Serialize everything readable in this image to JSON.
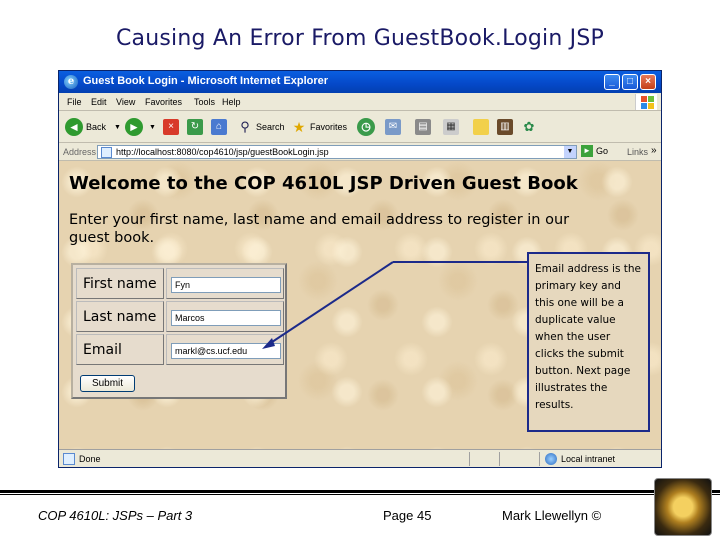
{
  "slide": {
    "title": "Causing An Error From GuestBook.Login JSP",
    "footer_course": "COP 4610L: JSPs – Part 3",
    "footer_page": "Page 45",
    "footer_author": "Mark Llewellyn ©"
  },
  "browser": {
    "window_title": "Guest Book Login - Microsoft Internet Explorer",
    "menu": [
      "File",
      "Edit",
      "View",
      "Favorites",
      "Tools",
      "Help"
    ],
    "toolbar": {
      "back_label": "Back",
      "search_label": "Search",
      "favorites_label": "Favorites"
    },
    "address": {
      "label": "Address",
      "url": "http://localhost:8080/cop4610/jsp/guestBookLogin.jsp",
      "go_label": "Go",
      "links_label": "Links"
    },
    "status": {
      "left": "Done",
      "zone": "Local intranet"
    }
  },
  "page": {
    "heading": "Welcome to the COP 4610L JSP Driven Guest Book",
    "instructions": "Enter your first name, last name and email address to register in our guest book.",
    "form": {
      "first_name_label": "First name",
      "first_name_value": "Fyn",
      "last_name_label": "Last name",
      "last_name_value": "Marcos",
      "email_label": "Email",
      "email_value": "markl@cs.ucf.edu",
      "submit_label": "Submit"
    }
  },
  "callout": {
    "text": "Email address is the primary key and this one will be a duplicate value when the user clicks the submit button. Next page illustrates the results."
  },
  "colors": {
    "title_text": "#1a1a66",
    "callout_border": "#1c2a8a",
    "callout_arrow": "#1c2a8a",
    "titlebar": "#0548c8"
  }
}
